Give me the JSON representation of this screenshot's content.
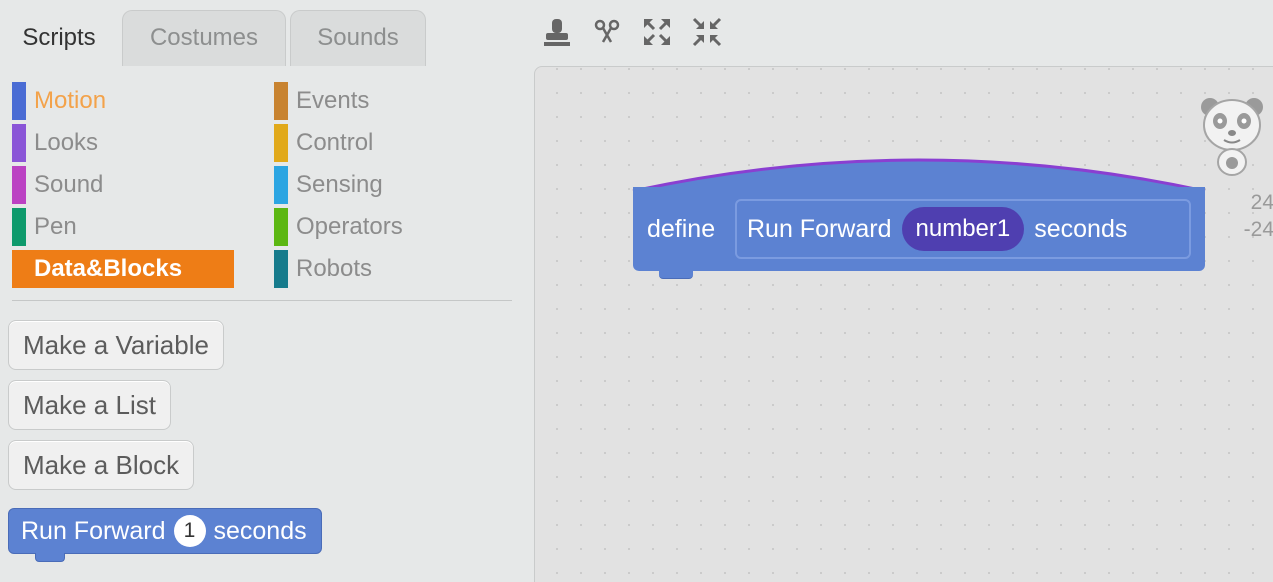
{
  "tabs": [
    {
      "label": "Scripts",
      "active": true
    },
    {
      "label": "Costumes",
      "active": false
    },
    {
      "label": "Sounds",
      "active": false
    }
  ],
  "toolbar": {
    "icons": [
      "stamp-icon",
      "cut-icon",
      "grow-icon",
      "shrink-icon"
    ]
  },
  "categories": [
    {
      "label": "Motion",
      "color": "#4a6cd4"
    },
    {
      "label": "Looks",
      "color": "#8a55d7"
    },
    {
      "label": "Sound",
      "color": "#bb42c3"
    },
    {
      "label": "Pen",
      "color": "#0e9a6c"
    },
    {
      "label": "Data&Blocks",
      "color": "#ee7d16",
      "selected": true
    },
    {
      "label": "Events",
      "color": "#c88330"
    },
    {
      "label": "Control",
      "color": "#e1a91a"
    },
    {
      "label": "Sensing",
      "color": "#2ca5e2"
    },
    {
      "label": "Operators",
      "color": "#5cb712"
    },
    {
      "label": "Robots",
      "color": "#167b8c"
    }
  ],
  "palette": {
    "make_variable": "Make a Variable",
    "make_list": "Make a List",
    "make_block": "Make a Block",
    "block": {
      "text1": "Run Forward",
      "value": "1",
      "text2": "seconds"
    }
  },
  "script": {
    "define_label": "define",
    "proto_text1": "Run Forward",
    "proto_arg": "number1",
    "proto_text2": "seconds",
    "coords_x": "24",
    "coords_y": "-24"
  },
  "colors": {
    "block_blue": "#5c82d2",
    "arg_purple": "#4f3fb0",
    "hat_outline": "#8a3fd1",
    "selected_orange": "#ee7d16"
  }
}
